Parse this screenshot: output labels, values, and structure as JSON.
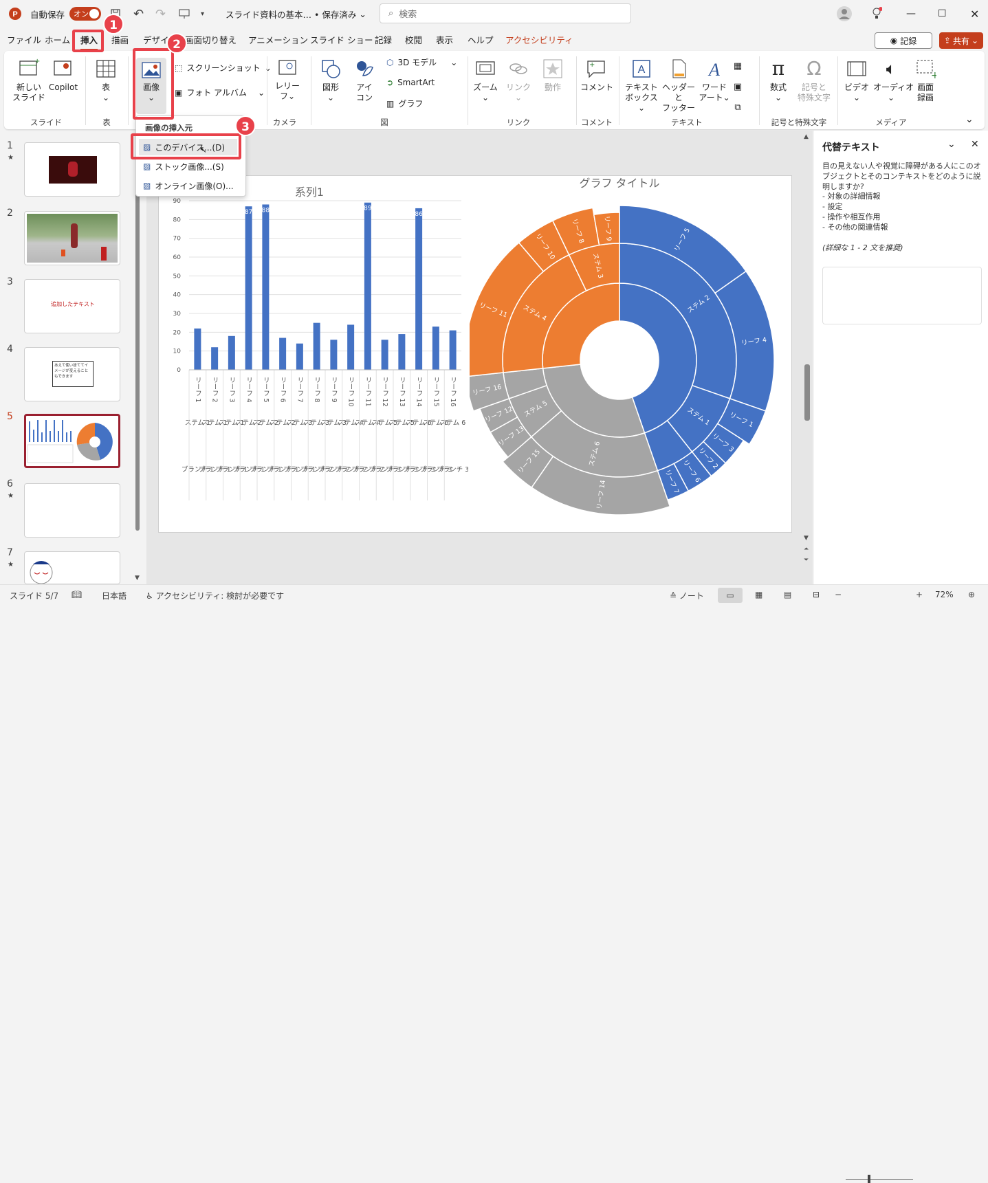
{
  "titlebar": {
    "autosave_label": "自動保存",
    "autosave_state": "オン",
    "doc_title": "スライド資料の基本… • 保存済み",
    "search_placeholder": "検索"
  },
  "tabs": [
    "ファイル",
    "ホーム",
    "挿入",
    "描画",
    "デザイン",
    "画面切り替え",
    "アニメーション",
    "スライド ショー",
    "記録",
    "校閲",
    "表示",
    "ヘルプ",
    "アクセシビリティ"
  ],
  "tab_actions": {
    "record": "記録",
    "share": "共有"
  },
  "ribbon": {
    "new_slide": "新しい\nスライド",
    "copilot": "Copilot",
    "table": "表",
    "image": "画像",
    "screenshot": "スクリーンショット",
    "photo_album": "フォト アルバム",
    "cameo": "レリー\nフ",
    "shapes": "図形",
    "icons": "アイ\nコン",
    "model3d": "3D モデル",
    "smartart": "SmartArt",
    "chart": "グラフ",
    "zoom": "ズーム",
    "link": "リンク",
    "action": "動作",
    "comment": "コメント",
    "textbox": "テキスト\nボックス",
    "header_footer": "ヘッダーと\nフッター",
    "wordart": "ワード\nアート",
    "equation": "数式",
    "symbol": "記号と\n特殊文字",
    "video": "ビデオ",
    "audio": "オーディオ",
    "screen_record": "画面\n録画",
    "groups": [
      "スライド",
      "表",
      "カメラ",
      "図",
      "リンク",
      "コメント",
      "テキスト",
      "記号と特殊文字",
      "メディア"
    ]
  },
  "dropdown": {
    "header": "画像の挿入元",
    "items": [
      "このデバイス...(D)",
      "ストック画像...(S)",
      "オンライン画像(O)..."
    ]
  },
  "badges": [
    "1",
    "2",
    "3"
  ],
  "thumbnails": [
    {
      "num": "1",
      "star": "★"
    },
    {
      "num": "2",
      "star": ""
    },
    {
      "num": "3",
      "star": "",
      "text": "追加したテキスト"
    },
    {
      "num": "4",
      "star": "",
      "text": "あえて使い捨ててイメージが変えることもできます"
    },
    {
      "num": "5",
      "star": ""
    },
    {
      "num": "6",
      "star": "★"
    },
    {
      "num": "7",
      "star": "★"
    }
  ],
  "pane": {
    "title": "代替テキスト",
    "description": "目の見えない人や視覚に障碍がある人にこのオブジェクトとそのコンテキストをどのように説明しますか?",
    "bullets": [
      "- 対象の詳細情報",
      "- 設定",
      "- 操作や相互作用",
      "- その他の関連情報"
    ],
    "hint": "(詳細な 1 - 2 文を推奨)"
  },
  "status": {
    "slide": "スライド 5/7",
    "lang": "日本語",
    "accessibility": "アクセシビリティ: 検討が必要です",
    "notes": "ノート",
    "zoom": "72%"
  },
  "colors": {
    "accent": "#c43e1c",
    "highlight": "#e8414a",
    "blue": "#4472c4",
    "orange": "#ed7d31",
    "gray": "#a5a5a5"
  },
  "chart_data": [
    {
      "type": "bar",
      "title": "系列1",
      "categories": [
        "リーフ 1",
        "リーフ 2",
        "リーフ 3",
        "リーフ 4",
        "リーフ 5",
        "リーフ 6",
        "リーフ 7",
        "リーフ 8",
        "リーフ 9",
        "リーフ 10",
        "リーフ 11",
        "リーフ 12",
        "リーフ 13",
        "リーフ 14",
        "リーフ 15",
        "リーフ 16"
      ],
      "stems": [
        "ステム 1",
        "ステム 1",
        "ステム 1",
        "ステム 2",
        "ステム 2",
        "ステム 2",
        "ステム 3",
        "ステム 3",
        "ステム 3",
        "ステム 4",
        "ステム 4",
        "ステム 5",
        "ステム 5",
        "ステム 6",
        "ステム 6",
        "ステム 6"
      ],
      "branches": [
        "ブランチ 1",
        "ブランチ 1",
        "ブランチ 1",
        "ブランチ 1",
        "ブランチ 1",
        "ブランチ 1",
        "ブランチ 1",
        "ブランチ 2",
        "ブランチ 2",
        "ブランチ 2",
        "ブランチ 2",
        "ブランチ 3",
        "ブランチ 3",
        "ブランチ 3",
        "ブランチ 3",
        "ブランチ 3"
      ],
      "values": [
        22,
        12,
        18,
        87,
        88,
        17,
        14,
        25,
        16,
        24,
        89,
        16,
        19,
        86,
        23,
        21
      ],
      "data_labels": {
        "3": "87",
        "4": "88",
        "10": "89",
        "13": "86"
      },
      "yticks": [
        0,
        10,
        20,
        30,
        40,
        50,
        60,
        70,
        80,
        90
      ],
      "ylim": [
        0,
        90
      ]
    },
    {
      "type": "sunburst",
      "title": "グラフ タイトル",
      "branches": [
        {
          "color": "#4472c4",
          "stems": [
            {
              "name": "ステム 2",
              "leaves": [
                {
                  "name": "リーフ 5",
                  "value": 88
                },
                {
                  "name": "リーフ 4",
                  "value": 87
                }
              ]
            },
            {
              "name": "ステム 1",
              "leaves": [
                {
                  "name": "リーフ 1",
                  "value": 22
                },
                {
                  "name": "リーフ 3",
                  "value": 18
                },
                {
                  "name": "リーフ 2",
                  "value": 12
                }
              ]
            },
            {
              "name": "",
              "leaves": [
                {
                  "name": "リーフ 6",
                  "value": 17
                },
                {
                  "name": "リーフ 7",
                  "value": 14
                }
              ]
            }
          ]
        },
        {
          "color": "#a5a5a5",
          "stems": [
            {
              "name": "ステム 6",
              "leaves": [
                {
                  "name": "リーフ 14",
                  "value": 86
                },
                {
                  "name": "リーフ 15",
                  "value": 23
                }
              ]
            },
            {
              "name": "ステム 5",
              "leaves": [
                {
                  "name": "リーフ 13",
                  "value": 19
                },
                {
                  "name": "リーフ 12",
                  "value": 16
                }
              ]
            },
            {
              "name": "",
              "leaves": [
                {
                  "name": "リーフ 16",
                  "value": 21
                }
              ]
            }
          ]
        },
        {
          "color": "#ed7d31",
          "stems": [
            {
              "name": "ステム 4",
              "leaves": [
                {
                  "name": "リーフ 11",
                  "value": 89
                },
                {
                  "name": "リーフ 10",
                  "value": 24
                }
              ]
            },
            {
              "name": "ステム 3",
              "leaves": [
                {
                  "name": "リーフ 8",
                  "value": 25
                },
                {
                  "name": "リーフ 9",
                  "value": 16
                }
              ]
            }
          ]
        }
      ]
    }
  ]
}
